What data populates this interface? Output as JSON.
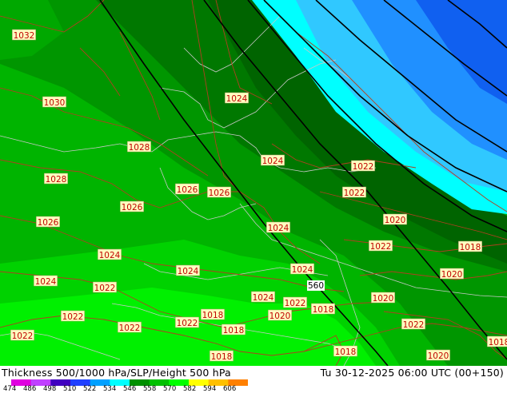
{
  "title": "Thickness 500/1000 hPa/SLP/Height 500 hPa",
  "valid_time": "Tu 30-12-2025 06:00 UTC (00+150)",
  "colorbar": {
    "labels": [
      "474",
      "486",
      "498",
      "510",
      "522",
      "534",
      "546",
      "558",
      "570",
      "582",
      "594",
      "606"
    ],
    "colors": [
      "#e000e0",
      "#c040ff",
      "#4000c0",
      "#2040ff",
      "#00a0ff",
      "#00ffff",
      "#009000",
      "#00c000",
      "#00ff00",
      "#ffff00",
      "#ffc000",
      "#ff8000"
    ]
  },
  "pressure_labels": [
    "1032",
    "1030",
    "1028",
    "1028",
    "1026",
    "1026",
    "1026",
    "1026",
    "1024",
    "1024",
    "1024",
    "1024",
    "1024",
    "1024",
    "1024",
    "1024",
    "1022",
    "1022",
    "1022",
    "1022",
    "1022",
    "1022",
    "1022",
    "1022",
    "1022",
    "1022",
    "1020",
    "1020",
    "1020",
    "1020",
    "1020",
    "1018",
    "1018",
    "1018",
    "1018",
    "1018",
    "1018",
    "1018"
  ],
  "height_label": "560"
}
